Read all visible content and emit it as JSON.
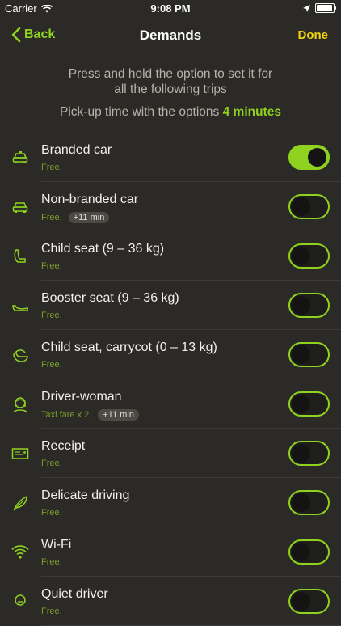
{
  "status": {
    "carrier": "Carrier",
    "time": "9:08 PM"
  },
  "nav": {
    "back_label": "Back",
    "title": "Demands",
    "done_label": "Done"
  },
  "info": {
    "hint_line1": "Press and hold the option to set it for",
    "hint_line2": "all the following trips",
    "pickup_text": "Pick-up time with the options",
    "pickup_value": "4 minutes"
  },
  "accent_color": "#8fd21f",
  "done_color": "#f0d20f",
  "options": [
    {
      "icon": "car-icon",
      "title": "Branded car",
      "sub": "Free.",
      "badge": "",
      "enabled": true
    },
    {
      "icon": "car-icon",
      "title": "Non-branded car",
      "sub": "Free.",
      "badge": "+11 min",
      "enabled": false
    },
    {
      "icon": "child-seat-icon",
      "title": "Child seat (9 – 36 kg)",
      "sub": "Free.",
      "badge": "",
      "enabled": false
    },
    {
      "icon": "booster-seat-icon",
      "title": "Booster seat (9 – 36 kg)",
      "sub": "Free.",
      "badge": "",
      "enabled": false
    },
    {
      "icon": "carrycot-icon",
      "title": "Child seat, carrycot (0 – 13 kg)",
      "sub": "Free.",
      "badge": "",
      "enabled": false
    },
    {
      "icon": "driver-woman-icon",
      "title": "Driver-woman",
      "sub": "Taxi fare x 2.",
      "badge": "+11 min",
      "enabled": false
    },
    {
      "icon": "receipt-icon",
      "title": "Receipt",
      "sub": "Free.",
      "badge": "",
      "enabled": false
    },
    {
      "icon": "feather-icon",
      "title": "Delicate driving",
      "sub": "Free.",
      "badge": "",
      "enabled": false
    },
    {
      "icon": "wifi-icon",
      "title": "Wi-Fi",
      "sub": "Free.",
      "badge": "",
      "enabled": false
    },
    {
      "icon": "quiet-driver-icon",
      "title": "Quiet driver",
      "sub": "Free.",
      "badge": "",
      "enabled": false
    }
  ]
}
